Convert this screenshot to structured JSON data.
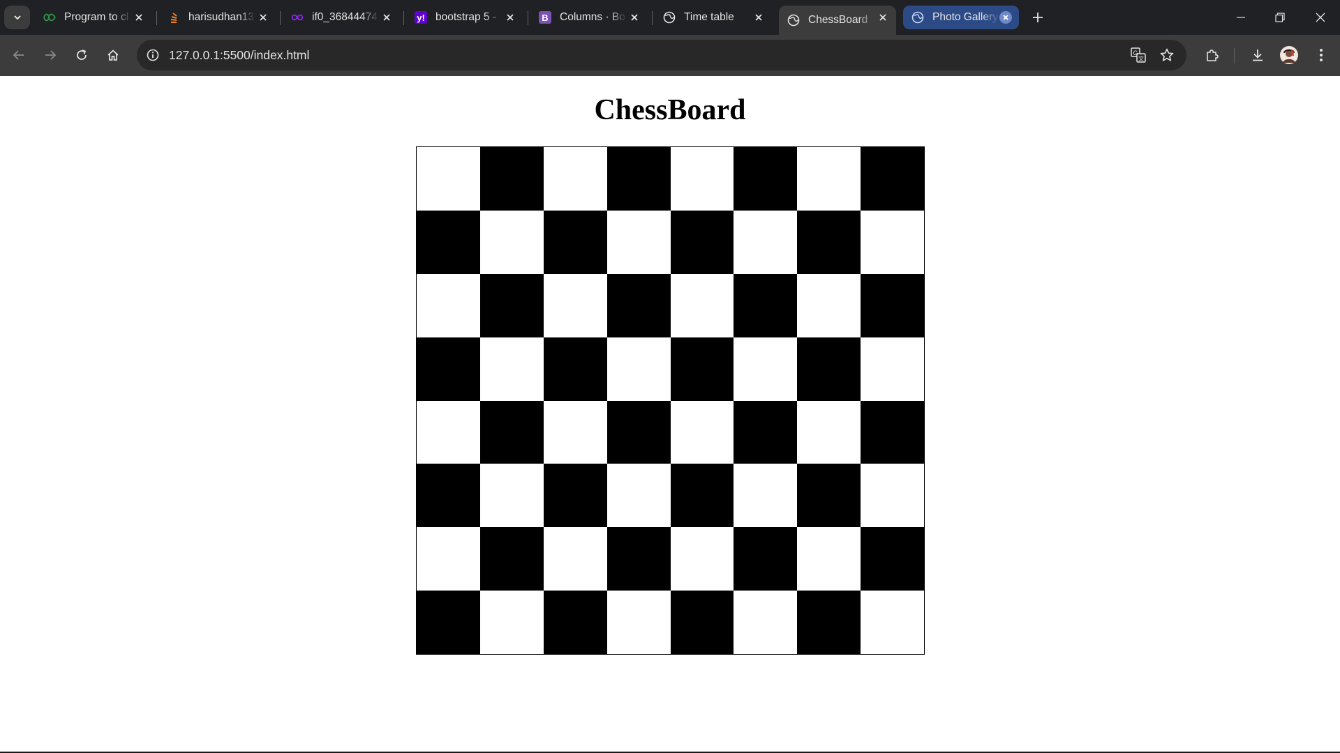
{
  "browser": {
    "tabs": [
      {
        "title": "Program to cl",
        "favicon": "gfg-icon",
        "active": false
      },
      {
        "title": "harisudhan13",
        "favicon": "stackoverflow-icon",
        "active": false
      },
      {
        "title": "if0_36844474",
        "favicon": "infinityfree-icon",
        "active": false
      },
      {
        "title": "bootstrap 5 -",
        "favicon": "yahoo-icon",
        "active": false
      },
      {
        "title": "Columns · Bo",
        "favicon": "bootstrap-icon",
        "active": false
      },
      {
        "title": "Time table",
        "favicon": "globe-icon",
        "active": false
      },
      {
        "title": "ChessBoard",
        "favicon": "globe-icon",
        "active": true
      },
      {
        "title": "Photo Gallery",
        "favicon": "globe-icon",
        "active": false
      }
    ],
    "url": "127.0.0.1:5500/index.html",
    "colors": {
      "tabstrip": "#202124",
      "toolbar": "#3c3c3c",
      "omnibox": "#282828",
      "grouped_tab": "#2c4a86"
    }
  },
  "page": {
    "title": "ChessBoard",
    "board": {
      "rows": 8,
      "cols": 8,
      "first_square": "light",
      "colors": {
        "light": "#ffffff",
        "dark": "#000000"
      }
    }
  }
}
